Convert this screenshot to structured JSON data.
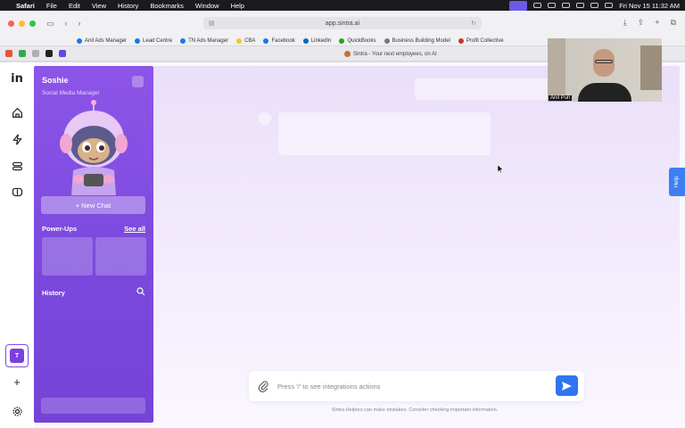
{
  "menubar": {
    "items": [
      "Safari",
      "File",
      "Edit",
      "View",
      "History",
      "Bookmarks",
      "Window",
      "Help"
    ],
    "clock": "Fri Nov 15  11:32 AM"
  },
  "browser": {
    "url": "app.sintra.ai",
    "tab_title": "Sintra - Your next employees, on AI",
    "bookmarks": [
      {
        "label": "Anil Ads Manager",
        "color": "#1877f2"
      },
      {
        "label": "Lead Centre",
        "color": "#1877f2"
      },
      {
        "label": "TN Ads Manager",
        "color": "#1877f2"
      },
      {
        "label": "CBA",
        "color": "#f3c623"
      },
      {
        "label": "Facebook",
        "color": "#1877f2"
      },
      {
        "label": "LinkedIn",
        "color": "#0a66c2"
      },
      {
        "label": "QuickBooks",
        "color": "#2ca01c"
      },
      {
        "label": "Business Building Model",
        "color": "#777777"
      },
      {
        "label": "Profit Collective",
        "color": "#c0392b"
      }
    ]
  },
  "sidebar": {
    "assistant_name": "Soshie",
    "assistant_role": "Social Media Manager",
    "new_chat_label": "+ New Chat",
    "powerups_title": "Power-Ups",
    "see_all_label": "See all",
    "history_title": "History"
  },
  "rail": {
    "active_initial": "T"
  },
  "composer": {
    "placeholder": "Press '/' to see integrations actions",
    "disclaimer": "Sintra Helpers can make mistakes. Consider checking important information."
  },
  "help_label": "Help",
  "webcam": {
    "name_caption": "Anil Puri"
  },
  "colors": {
    "accent": "#7b3fe0",
    "send_button": "#2f74f0",
    "help_tab": "#3d7ff2"
  }
}
